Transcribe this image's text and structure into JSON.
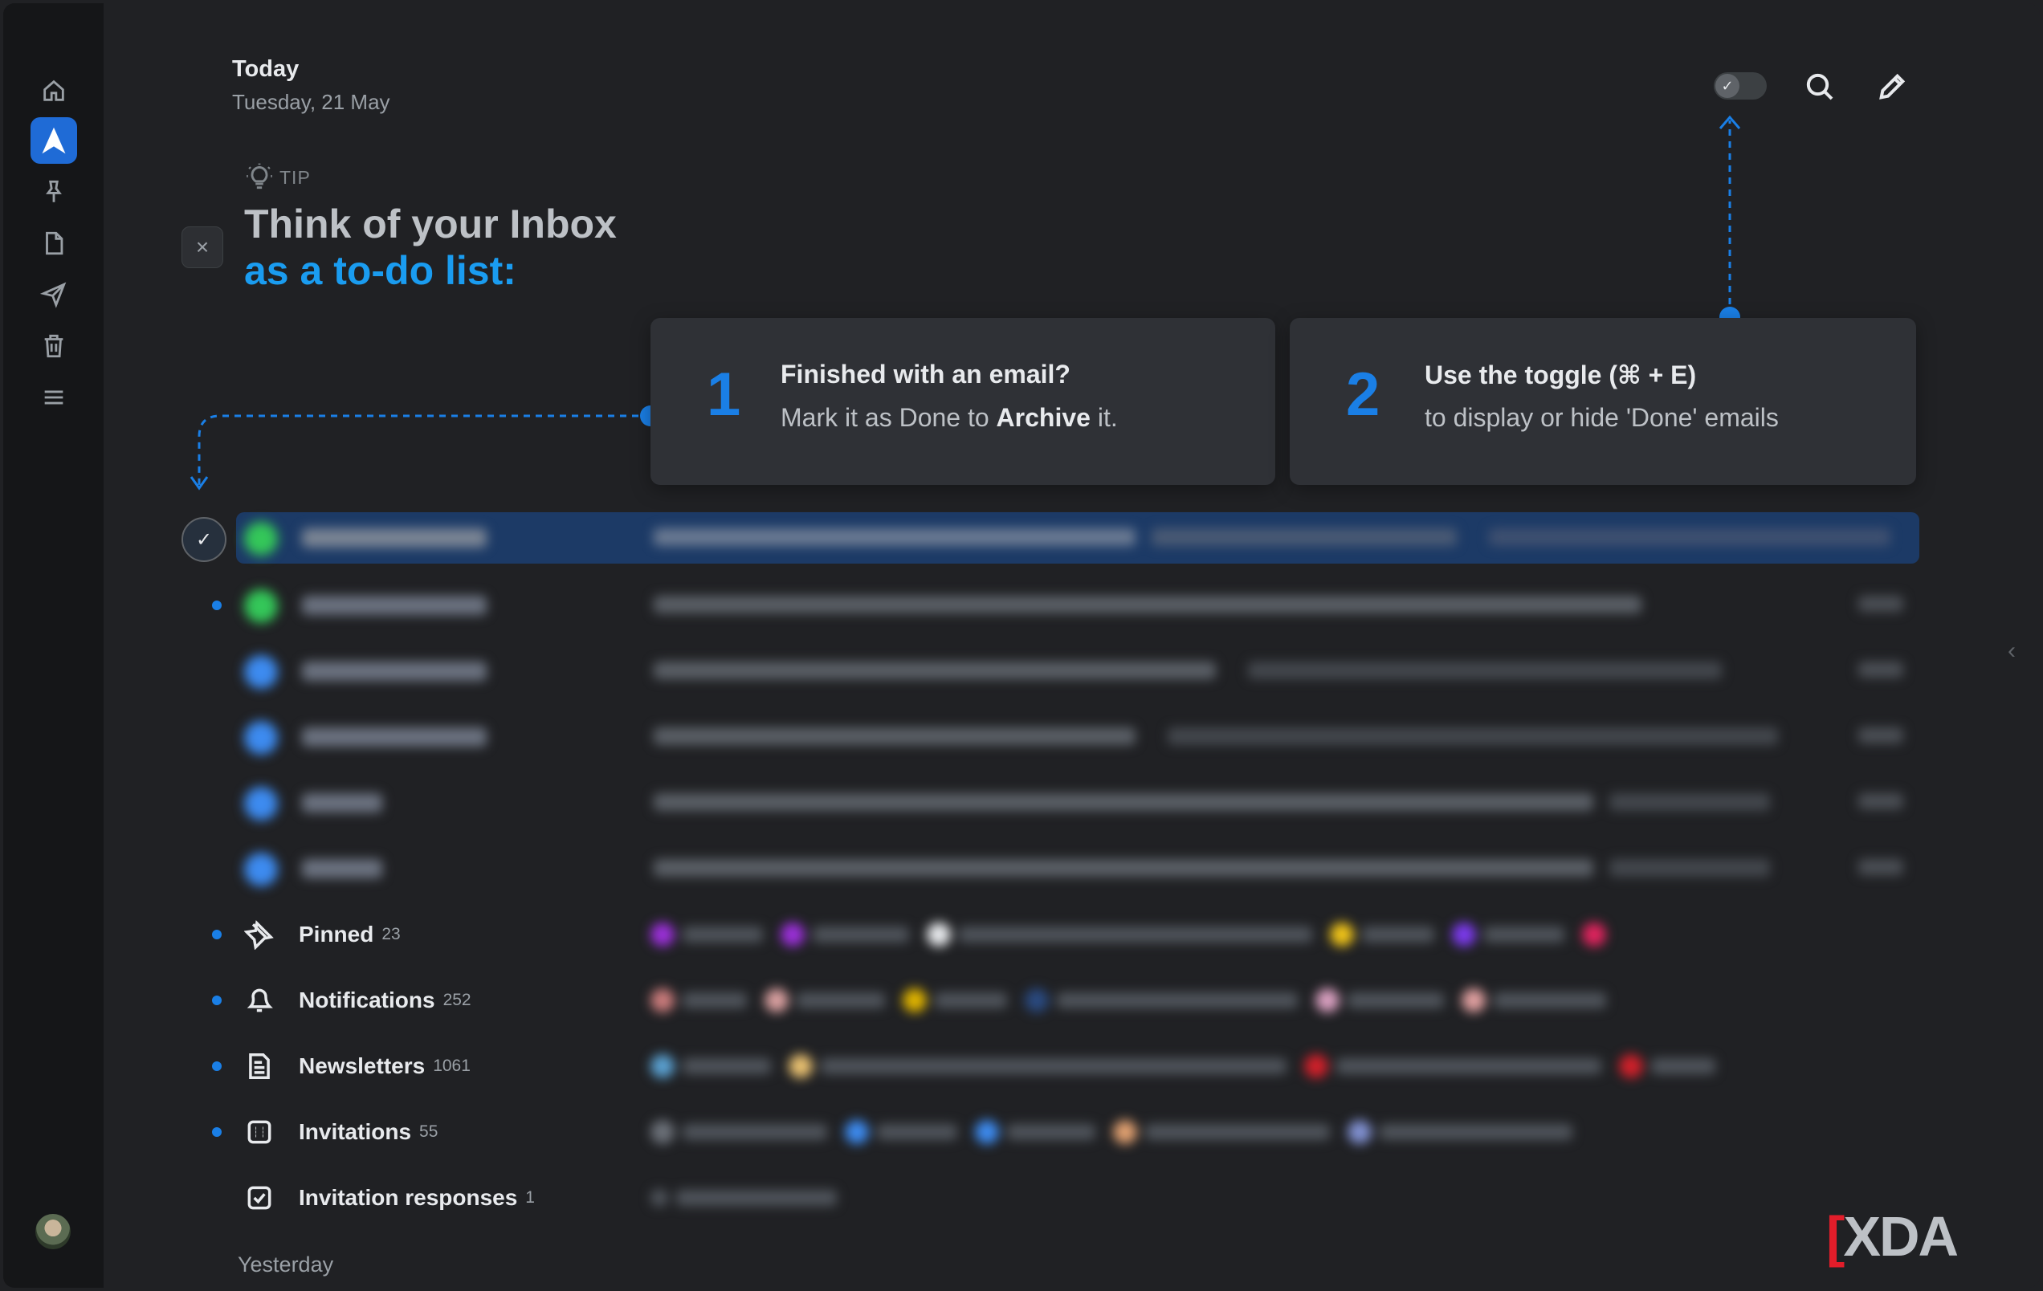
{
  "window": {
    "traffic_lights": [
      "#ff5f57",
      "#febc2e",
      "#28c840"
    ]
  },
  "sidebar": {
    "items": [
      {
        "name": "home-icon"
      },
      {
        "name": "send-arrow-icon",
        "active": true
      },
      {
        "name": "pin-icon"
      },
      {
        "name": "document-icon"
      },
      {
        "name": "paper-plane-icon"
      },
      {
        "name": "trash-icon"
      },
      {
        "name": "menu-icon"
      }
    ]
  },
  "header": {
    "title": "Today",
    "date": "Tuesday, 21 May"
  },
  "tip": {
    "label": "TIP",
    "headline_1": "Think of your Inbox",
    "headline_2": "as a to-do list:",
    "close_glyph": "×"
  },
  "cards": [
    {
      "number": "1",
      "line1": "Finished with an email?",
      "line2_prefix": "Mark it as Done to ",
      "line2_bold": "Archive",
      "line2_suffix": " it."
    },
    {
      "number": "2",
      "line1": "Use the toggle (⌘ + E)",
      "line2_prefix": "to display or hide 'Done' emails",
      "line2_bold": "",
      "line2_suffix": ""
    }
  ],
  "categories": [
    {
      "label": "Pinned",
      "count": "23",
      "icon": "pin-icon",
      "unread": true
    },
    {
      "label": "Notifications",
      "count": "252",
      "icon": "bell-icon",
      "unread": true
    },
    {
      "label": "Newsletters",
      "count": "1061",
      "icon": "newspaper-icon",
      "unread": true
    },
    {
      "label": "Invitations",
      "count": "55",
      "icon": "calendar-icon",
      "unread": true
    },
    {
      "label": "Invitation responses",
      "count": "1",
      "icon": "calendar-check-icon",
      "unread": false
    }
  ],
  "section": {
    "yesterday": "Yesterday"
  },
  "watermark": {
    "text": "XDA"
  },
  "colors": {
    "accent": "#1a7fe6",
    "tip_highlight": "#1a9cf0",
    "background": "#202124",
    "sidebar": "#151618"
  }
}
